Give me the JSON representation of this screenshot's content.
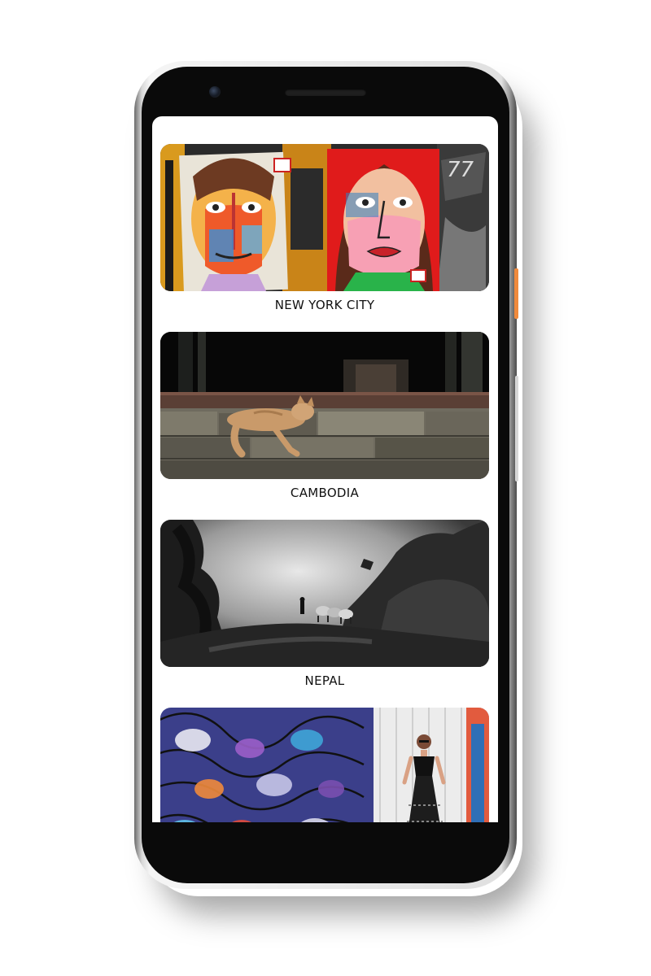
{
  "device": {
    "accent_button_color": "#f08a3c",
    "frame_color": "#0a0a0a"
  },
  "gallery": {
    "items": [
      {
        "label": "NEW YORK CITY",
        "image": "street-art-faces-mural"
      },
      {
        "label": "CAMBODIA",
        "image": "cat-sleeping-on-stone-ledge"
      },
      {
        "label": "NEPAL",
        "image": "misty-mountain-trail-with-porters"
      },
      {
        "label": "",
        "image": "woman-in-front-of-colorful-mural"
      }
    ]
  }
}
